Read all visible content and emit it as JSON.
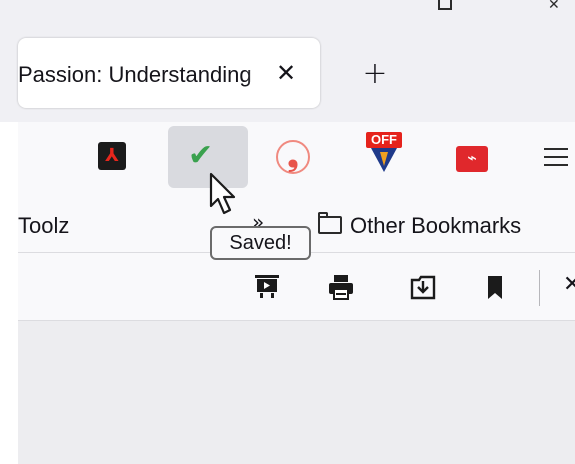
{
  "tab": {
    "title": "Passion: Understanding",
    "close_glyph": "✕",
    "new_tab_glyph": "+"
  },
  "toolbar": {
    "extensions": [
      {
        "name": "adobe-acrobat",
        "glyph": "⅄"
      },
      {
        "name": "saved-check",
        "glyph": "✔"
      },
      {
        "name": "quote-extension",
        "glyph": "❟"
      },
      {
        "name": "off-extension",
        "badge": "OFF"
      },
      {
        "name": "m-extension",
        "glyph": "⌁"
      }
    ],
    "saved_tooltip": "Saved!"
  },
  "bookmarks": {
    "left_label": "Toolz",
    "chevron": "»",
    "other_label": "Other Bookmarks"
  },
  "pdf_toolbar": {
    "close_glyph": "✕"
  },
  "colors": {
    "check_green": "#3aa14e",
    "adobe_red": "#e8261c",
    "off_red": "#e5231c",
    "m_red": "#e0282c",
    "hover_bg": "#d9dadf"
  }
}
